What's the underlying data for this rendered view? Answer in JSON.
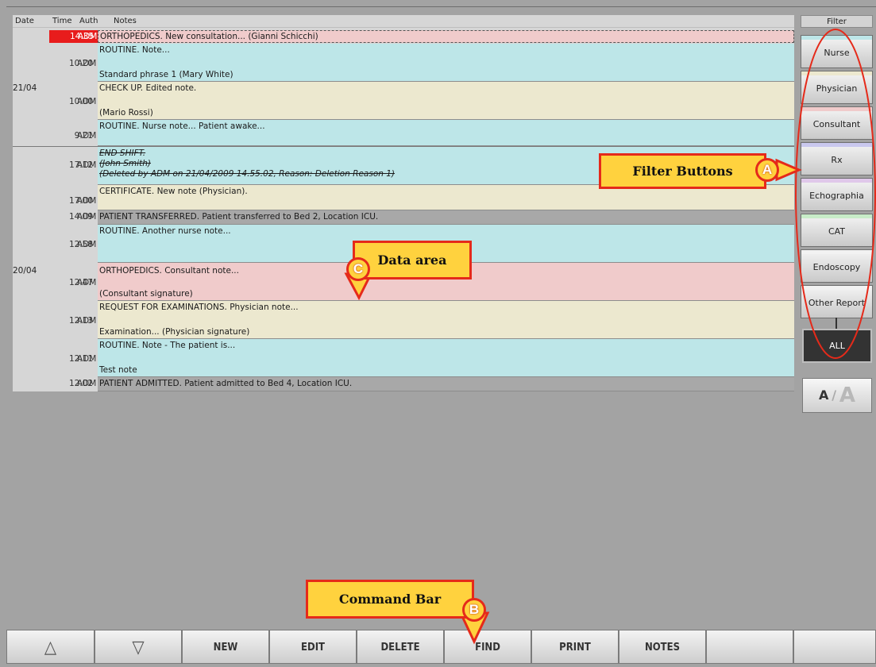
{
  "table": {
    "headers": {
      "date": "Date",
      "time": "Time",
      "auth": "Auth",
      "notes": "Notes"
    },
    "groups": [
      {
        "date": "21/04"
      },
      {
        "date": "20/04"
      }
    ],
    "rows": [
      {
        "time": "14.35",
        "auth": "ADM",
        "lines": [
          "ORTHOPEDICS. New consultation... (Gianni Schicchi)"
        ],
        "type": "orthopedics",
        "selected": true
      },
      {
        "time": "10.20",
        "auth": "ADM",
        "lines": [
          "ROUTINE. Note...",
          "Standard phrase 1  (Mary White)"
        ],
        "type": "routine"
      },
      {
        "time": "10.00",
        "auth": "ADM",
        "lines": [
          "CHECK UP. Edited note.",
          "(Mario Rossi)"
        ],
        "type": "checkup"
      },
      {
        "time": "9.21",
        "auth": "ADM",
        "lines": [
          "ROUTINE. Nurse note... Patient awake..."
        ],
        "type": "routine"
      },
      {
        "time": "17.12",
        "auth": "ADM",
        "lines": [
          "END SHIFT.",
          "(John Smith)",
          "(Deleted by ADM on 21/04/2009 14.55.02, Reason: Deletion Reason 1)"
        ],
        "type": "routine",
        "deleted": true
      },
      {
        "time": "17.00",
        "auth": "ADM",
        "lines": [
          "CERTIFICATE. New note (Physician)."
        ],
        "type": "checkup"
      },
      {
        "time": "14.09",
        "auth": "ADM",
        "lines": [
          "PATIENT TRANSFERRED. Patient transferred to Bed 2, Location ICU."
        ],
        "type": "system"
      },
      {
        "time": "12.58",
        "auth": "ADM",
        "lines": [
          "ROUTINE. Another nurse note..."
        ],
        "type": "routine"
      },
      {
        "time": "12.47",
        "auth": "ADM",
        "lines": [
          "ORTHOPEDICS. Consultant note...",
          "(Consultant signature)"
        ],
        "type": "orthopedics"
      },
      {
        "time": "12.13",
        "auth": "ADM",
        "lines": [
          "REQUEST FOR EXAMINATIONS. Physician note...",
          "Examination... (Physician signature)"
        ],
        "type": "checkup"
      },
      {
        "time": "12.11",
        "auth": "ADM",
        "lines": [
          "ROUTINE. Note - The patient is...",
          "Test note"
        ],
        "type": "routine"
      },
      {
        "time": "12.02",
        "auth": "ADM",
        "lines": [
          "PATIENT ADMITTED. Patient admitted to Bed 4, Location ICU."
        ],
        "type": "system"
      }
    ]
  },
  "filter": {
    "title": "Filter",
    "buttons": [
      {
        "label": "Nurse",
        "color": "#bde6e8"
      },
      {
        "label": "Physician",
        "color": "#ece8cf"
      },
      {
        "label": "Consultant",
        "color": "#f0cbcb"
      },
      {
        "label": "Rx",
        "color": "#c9c8ee"
      },
      {
        "label": "Echographia",
        "color": "#e0c8ea"
      },
      {
        "label": "CAT",
        "color": "#c8ecc8"
      },
      {
        "label": "Endoscopy",
        "color": "#f2f2f2"
      },
      {
        "label": "Other Report",
        "color": "#f2f2f2"
      }
    ],
    "all_label": "ALL",
    "font_toggle": {
      "small": "A",
      "sep": "/",
      "big": "A"
    }
  },
  "command_bar": {
    "buttons": [
      "△",
      "▽",
      "NEW",
      "EDIT",
      "DELETE",
      "FIND",
      "PRINT",
      "NOTES",
      "",
      ""
    ]
  },
  "annotations": {
    "filter_buttons": {
      "text": "Filter Buttons",
      "marker": "A"
    },
    "command_bar": {
      "text": "Command Bar",
      "marker": "B"
    },
    "data_area": {
      "text": "Data area",
      "marker": "C"
    }
  },
  "colors": {
    "orthopedics": "#f0cbcb",
    "routine": "#bde6e8",
    "checkup": "#ece8cf",
    "system": "#a8a8a8",
    "selected": "#e81c1c",
    "callout_fill": "#ffd23e",
    "callout_border": "#e52a1a"
  }
}
